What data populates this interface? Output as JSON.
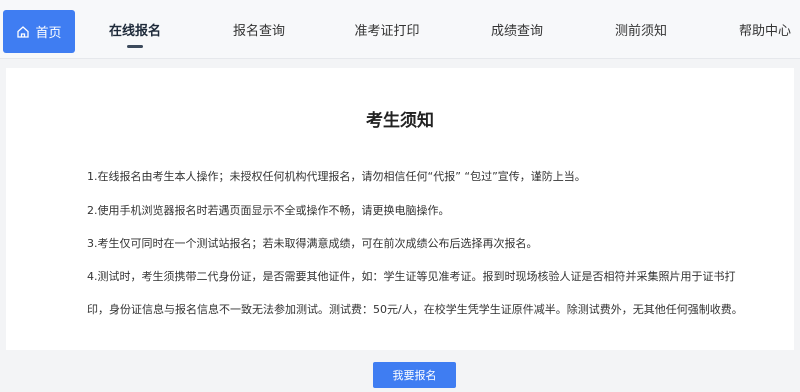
{
  "nav": {
    "home_label": "首页",
    "tabs": [
      {
        "label": "在线报名",
        "active": true
      },
      {
        "label": "报名查询"
      },
      {
        "label": "准考证打印"
      },
      {
        "label": "成绩查询"
      },
      {
        "label": "测前须知"
      },
      {
        "label": "帮助中心"
      }
    ]
  },
  "notice": {
    "title": "考生须知",
    "items": [
      "1.在线报名由考生本人操作；未授权任何机构代理报名，请勿相信任何“代报” “包过”宣传，谨防上当。",
      "2.使用手机浏览器报名时若遇页面显示不全或操作不畅，请更换电脑操作。",
      "3.考生仅可同时在一个测试站报名；若未取得满意成绩，可在前次成绩公布后选择再次报名。",
      "4.测试时，考生须携带二代身份证，是否需要其他证件，如：学生证等见准考证。报到时现场核验人证是否相符并采集照片用于证书打",
      "印，身份证信息与报名信息不一致无法参加测试。测试费：50元/人，在校学生凭学生证原件减半。除测试费外，无其他任何强制收费。"
    ]
  },
  "actions": {
    "register_label": "我要报名"
  },
  "colors": {
    "accent": "#3f7df2",
    "nav_bg": "#f7f8fa",
    "page_bg": "#f3f4f6"
  }
}
